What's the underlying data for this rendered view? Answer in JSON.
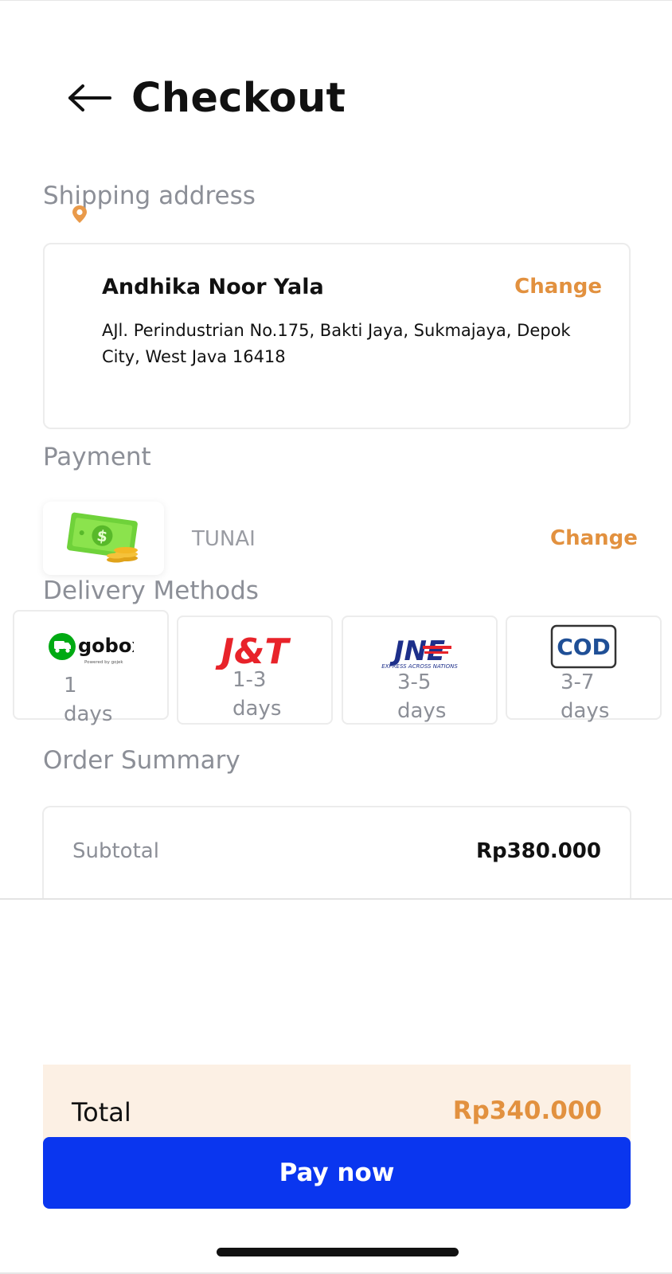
{
  "header": {
    "title": "Checkout",
    "back_icon": "arrow-left-icon"
  },
  "shipping": {
    "section_label": "Shipping address",
    "icon": "location-pin-icon",
    "name": "Andhika Noor Yala",
    "change_label": "Change",
    "address": "AJl. Perindustrian No.175, Bakti Jaya, Sukmajaya, Depok City, West Java 16418"
  },
  "payment": {
    "section_label": "Payment",
    "icon": "cash-money-icon",
    "method": "TUNAI",
    "change_label": "Change"
  },
  "delivery": {
    "section_label": "Delivery Methods",
    "options": [
      {
        "logo_text": "gobox",
        "logo_sub": "Powered by gojek",
        "days_num": "1",
        "days_label": "days"
      },
      {
        "logo_text": "J&T",
        "days_num": "1-3",
        "days_label": "days"
      },
      {
        "logo_text": "JNE",
        "logo_sub": "EXPRESS ACROSS NATIONS",
        "days_num": "3-5",
        "days_label": "days"
      },
      {
        "logo_text": "COD",
        "days_num": "3-7",
        "days_label": "days"
      }
    ]
  },
  "summary": {
    "section_label": "Order Summary",
    "subtotal_label": "Subtotal",
    "subtotal_value": "Rp380.000"
  },
  "total": {
    "label": "Total",
    "value": "Rp340.000"
  },
  "pay_button": {
    "label": "Pay now"
  },
  "colors": {
    "accent": "#e2913f",
    "primary": "#0a36ef",
    "muted": "#8c8f97",
    "total_bg": "#fcf0e4"
  }
}
